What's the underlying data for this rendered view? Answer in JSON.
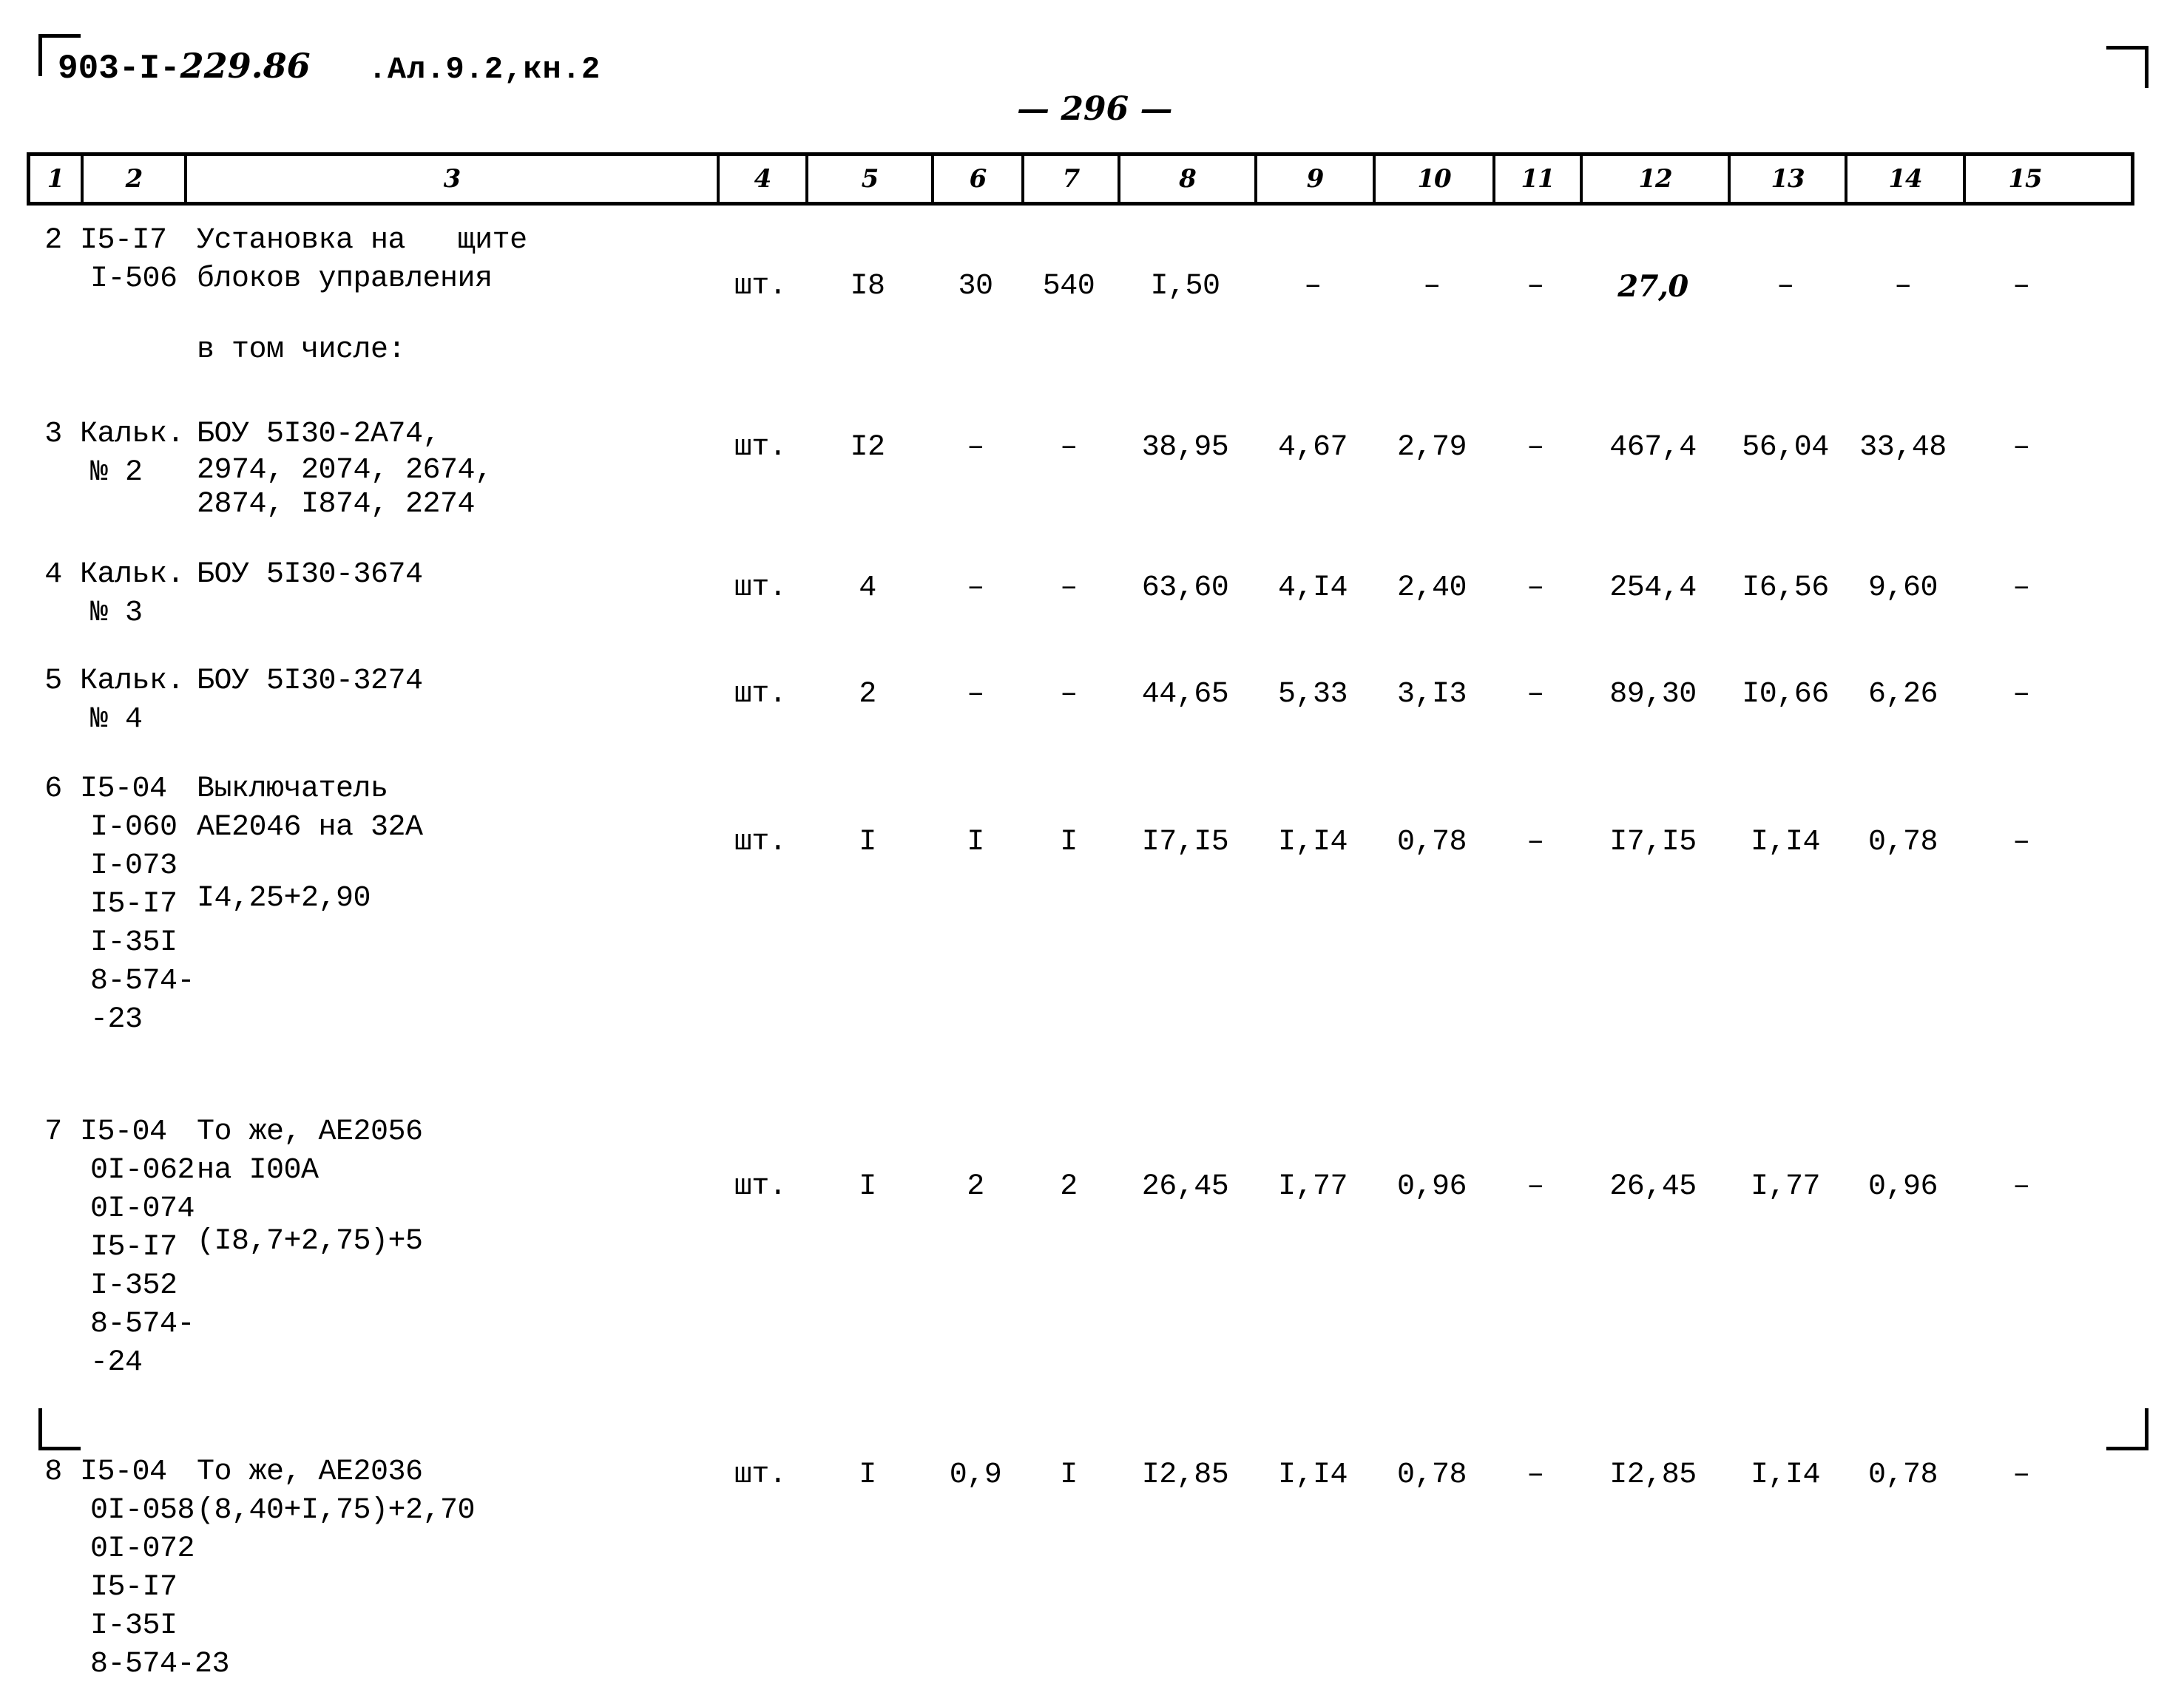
{
  "document": {
    "code_prefix": "903-",
    "code_roman": "I",
    "code_sep": "-",
    "code_number": "229.86",
    "album": ".Ал.9.2,кн.2",
    "page_label": "— 296 —"
  },
  "table": {
    "column_headers": [
      "1",
      "2",
      "3",
      "4",
      "5",
      "6",
      "7",
      "8",
      "9",
      "10",
      "11",
      "12",
      "13",
      "14",
      "15"
    ],
    "rows": [
      {
        "no": "2",
        "codes": [
          "I5-I7",
          "I-506"
        ],
        "desc_lines": [
          "Установка на   щите",
          "блоков управления"
        ],
        "desc_extra": [
          "в том числе:"
        ],
        "unit": "шт.",
        "c5": "I8",
        "c6": "30",
        "c7": "540",
        "c8": "I,50",
        "c9": "–",
        "c10": "–",
        "c11": "–",
        "c12": "27,0",
        "c12_hand": true,
        "c13": "–",
        "c14": "–",
        "c15": "–"
      },
      {
        "no": "3",
        "codes": [
          "Кальк.",
          "№ 2"
        ],
        "desc_lines": [
          "БОУ 5I30-2А74,",
          "2974, 2074, 2674,",
          "2874, I874, 2274"
        ],
        "desc_extra": [],
        "unit": "шт.",
        "c5": "I2",
        "c6": "–",
        "c7": "–",
        "c8": "38,95",
        "c9": "4,67",
        "c10": "2,79",
        "c11": "–",
        "c12": "467,4",
        "c12_hand": false,
        "c13": "56,04",
        "c14": "33,48",
        "c15": "–"
      },
      {
        "no": "4",
        "codes": [
          "Кальк.",
          "№ 3"
        ],
        "desc_lines": [
          "БОУ 5I30-3674"
        ],
        "desc_extra": [],
        "unit": "шт.",
        "c5": "4",
        "c6": "–",
        "c7": "–",
        "c8": "63,60",
        "c9": "4,I4",
        "c10": "2,40",
        "c11": "–",
        "c12": "254,4",
        "c12_hand": false,
        "c13": "I6,56",
        "c14": "9,60",
        "c15": "–"
      },
      {
        "no": "5",
        "codes": [
          "Кальк.",
          "№ 4"
        ],
        "desc_lines": [
          "БОУ 5I30-3274"
        ],
        "desc_extra": [],
        "unit": "шт.",
        "c5": "2",
        "c6": "–",
        "c7": "–",
        "c8": "44,65",
        "c9": "5,33",
        "c10": "3,I3",
        "c11": "–",
        "c12": "89,30",
        "c12_hand": false,
        "c13": "I0,66",
        "c14": "6,26",
        "c15": "–"
      },
      {
        "no": "6",
        "codes": [
          "I5-04",
          "I-060",
          "I-073",
          "I5-I7",
          "I-35I",
          "8-574-",
          "-23"
        ],
        "desc_lines": [
          "Выключатель",
          "АЕ2046 на 32А"
        ],
        "desc_extra": [
          "I4,25+2,90"
        ],
        "unit": "шт.",
        "c5": "I",
        "c6": "I",
        "c7": "I",
        "c8": "I7,I5",
        "c9": "I,I4",
        "c10": "0,78",
        "c11": "–",
        "c12": "I7,I5",
        "c12_hand": false,
        "c13": "I,I4",
        "c14": "0,78",
        "c15": "–"
      },
      {
        "no": "7",
        "codes": [
          "I5-04",
          "0I-062",
          "0I-074",
          "I5-I7",
          "I-352",
          "8-574-",
          "-24"
        ],
        "desc_lines": [
          "То же, АЕ2056",
          "на I00А"
        ],
        "desc_extra": [
          "(I8,7+2,75)+5"
        ],
        "unit": "шт.",
        "c5": "I",
        "c6": "2",
        "c7": "2",
        "c8": "26,45",
        "c9": "I,77",
        "c10": "0,96",
        "c11": "–",
        "c12": "26,45",
        "c12_hand": false,
        "c13": "I,77",
        "c14": "0,96",
        "c15": "–"
      },
      {
        "no": "8",
        "codes": [
          "I5-04",
          "0I-058",
          "0I-072",
          "I5-I7",
          "I-35I",
          "8-574-23"
        ],
        "desc_lines": [
          "То же, АЕ2036",
          "(8,40+I,75)+2,70"
        ],
        "desc_extra": [],
        "unit": "шт.",
        "c5": "I",
        "c6": "0,9",
        "c7": "I",
        "c8": "I2,85",
        "c9": "I,I4",
        "c10": "0,78",
        "c11": "–",
        "c12": "I2,85",
        "c12_hand": false,
        "c13": "I,I4",
        "c14": "0,78",
        "c15": "–"
      }
    ]
  }
}
